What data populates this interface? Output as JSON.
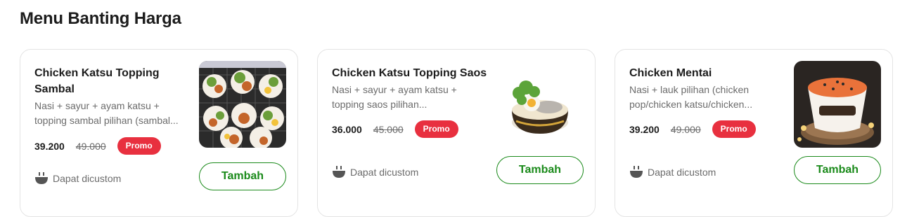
{
  "section": {
    "title": "Menu Banting Harga"
  },
  "cards": [
    {
      "title": "Chicken Katsu Topping Sambal",
      "description": "Nasi + sayur + ayam katsu + topping sambal pilihan (sambal...",
      "price": "39.200",
      "old_price": "49.000",
      "badge": "Promo",
      "custom_label": "Dapat dicustom",
      "button": "Tambah",
      "image_icon": "food-bowls-photo"
    },
    {
      "title": "Chicken Katsu Topping Saos",
      "description": "Nasi + sayur + ayam katsu + topping saos pilihan...",
      "price": "36.000",
      "old_price": "45.000",
      "badge": "Promo",
      "custom_label": "Dapat dicustom",
      "button": "Tambah",
      "image_icon": "rice-bowl-photo"
    },
    {
      "title": "Chicken Mentai",
      "description": "Nasi + lauk pilihan (chicken pop/chicken katsu/chicken...",
      "price": "39.200",
      "old_price": "49.000",
      "badge": "Promo",
      "custom_label": "Dapat dicustom",
      "button": "Tambah",
      "image_icon": "mentai-bowl-photo"
    }
  ],
  "colors": {
    "accent": "#1a8a1a",
    "promo": "#e8303f",
    "muted": "#6b6b6b"
  }
}
